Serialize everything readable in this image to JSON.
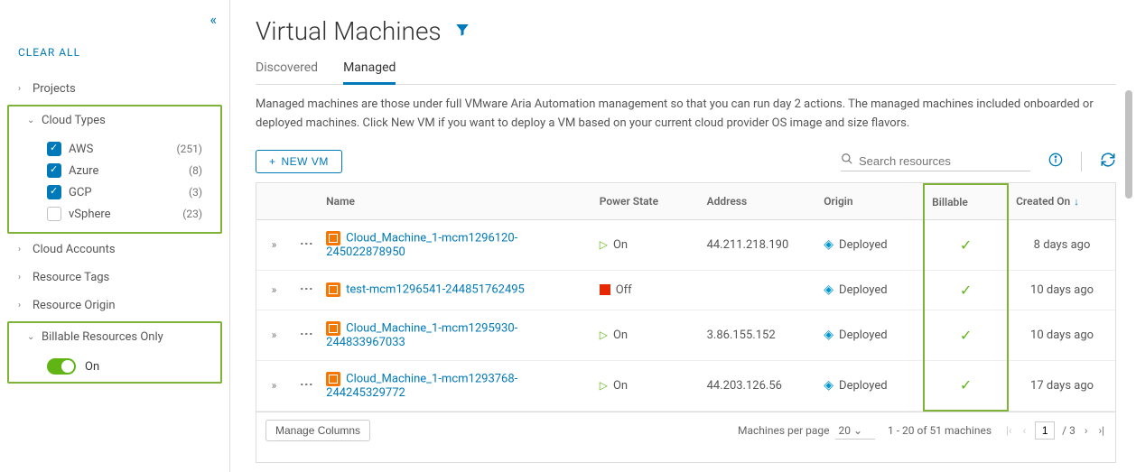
{
  "sidebar": {
    "clear_all": "CLEAR ALL",
    "groups": [
      {
        "label": "Projects",
        "expanded": false
      },
      {
        "label": "Cloud Types",
        "expanded": true,
        "highlighted": true,
        "items": [
          {
            "label": "AWS",
            "checked": true,
            "count": "(251)"
          },
          {
            "label": "Azure",
            "checked": true,
            "count": "(8)"
          },
          {
            "label": "GCP",
            "checked": true,
            "count": "(3)"
          },
          {
            "label": "vSphere",
            "checked": false,
            "count": "(23)"
          }
        ]
      },
      {
        "label": "Cloud Accounts",
        "expanded": false
      },
      {
        "label": "Resource Tags",
        "expanded": false
      },
      {
        "label": "Resource Origin",
        "expanded": false
      },
      {
        "label": "Billable Resources Only",
        "expanded": true,
        "highlighted": true,
        "toggle": {
          "label": "On",
          "value": true
        }
      }
    ]
  },
  "page": {
    "title": "Virtual Machines",
    "tabs": [
      {
        "label": "Discovered",
        "active": false
      },
      {
        "label": "Managed",
        "active": true
      }
    ],
    "description": "Managed machines are those under full VMware Aria Automation management so that you can run day 2 actions. The managed machines included onboarded or deployed machines. Click New VM if you want to deploy a VM based on your current cloud provider OS image and size flavors."
  },
  "toolbar": {
    "new_vm": "NEW VM",
    "search_placeholder": "Search resources"
  },
  "table": {
    "columns": {
      "name": "Name",
      "power": "Power State",
      "address": "Address",
      "origin": "Origin",
      "billable": "Billable",
      "created": "Created On"
    },
    "rows": [
      {
        "name": "Cloud_Machine_1-mcm1296120-245022878950",
        "power": "On",
        "address": "44.211.218.190",
        "origin": "Deployed",
        "billable": true,
        "created": "8 days ago"
      },
      {
        "name": "test-mcm1296541-244851762495",
        "power": "Off",
        "address": "",
        "origin": "Deployed",
        "billable": true,
        "created": "10 days ago"
      },
      {
        "name": "Cloud_Machine_1-mcm1295930-244833967033",
        "power": "On",
        "address": "3.86.155.152",
        "origin": "Deployed",
        "billable": true,
        "created": "10 days ago"
      },
      {
        "name": "Cloud_Machine_1-mcm1293768-244245329772",
        "power": "On",
        "address": "44.203.126.56",
        "origin": "Deployed",
        "billable": true,
        "created": "17 days ago"
      }
    ]
  },
  "footer": {
    "manage_cols": "Manage Columns",
    "per_page_label": "Machines per page",
    "per_page_value": "20",
    "range": "1 - 20 of 51 machines",
    "page_current": "1",
    "page_total": "/ 3"
  }
}
